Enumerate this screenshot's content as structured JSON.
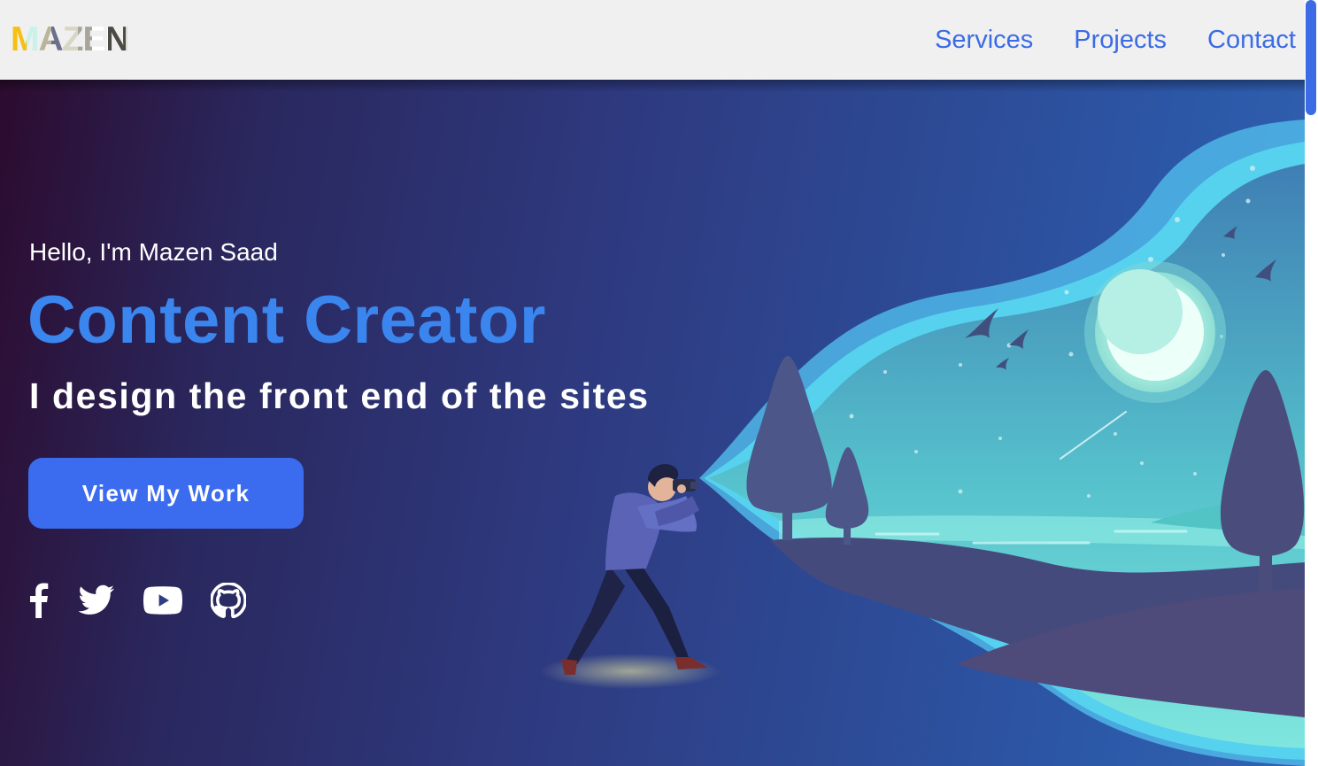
{
  "brand": {
    "logo_text": "MAZEN"
  },
  "nav": {
    "links": [
      {
        "label": "Services"
      },
      {
        "label": "Projects"
      },
      {
        "label": "Contact"
      }
    ],
    "link_color": "#3b6ce6"
  },
  "hero": {
    "greeting": "Hello, I'm Mazen Saad",
    "headline": "Content Creator",
    "subtitle": "I design the front end of the sites",
    "cta_label": "View My Work",
    "accent_color": "#3a86ee",
    "button_color": "#3b6cf0",
    "socials": [
      {
        "icon": "facebook-icon"
      },
      {
        "icon": "twitter-icon"
      },
      {
        "icon": "youtube-icon"
      },
      {
        "icon": "github-icon"
      }
    ]
  }
}
